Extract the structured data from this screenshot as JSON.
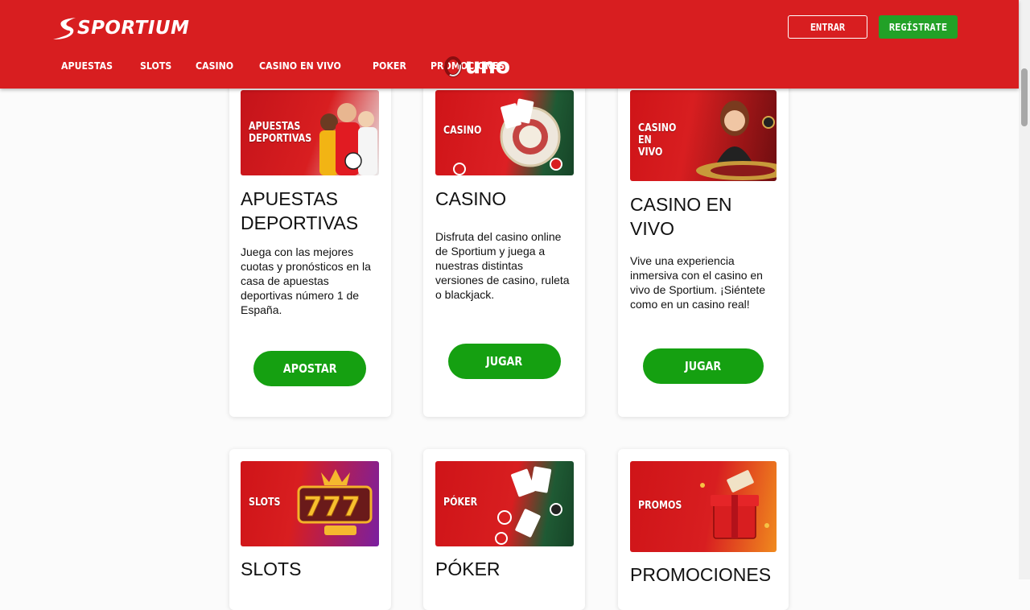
{
  "brand": {
    "name": "SPORTIUM",
    "accent": "#d81e20",
    "green": "#22a127"
  },
  "header": {
    "login_label": "ENTRAR",
    "register_label": "REGÍSTRATE",
    "nav": [
      "APUESTAS",
      "SLOTS",
      "CASINO",
      "CASINO EN VIVO",
      "POKER",
      "PROMOCIONES"
    ],
    "partner_logo": "uno"
  },
  "cards": [
    {
      "image_label": "APUESTAS DEPORTIVAS",
      "title": "APUESTAS DEPORTIVAS",
      "description": "Juega con las mejores cuotas y pronósticos en la casa de apuestas deportivas número 1 de España.",
      "button": "APOSTAR"
    },
    {
      "image_label": "CASINO",
      "title": "CASINO",
      "description": "Disfruta del casino online de Sportium y juega a nuestras distintas versiones de casino, ruleta o blackjack.",
      "button": "JUGAR"
    },
    {
      "image_label": "CASINO EN VIVO",
      "title": "CASINO EN VIVO",
      "description": "Vive una experiencia inmersiva con el casino en vivo de Sportium. ¡Siéntete como en un casino real!",
      "button": "JUGAR"
    },
    {
      "image_label": "SLOTS",
      "title": "SLOTS"
    },
    {
      "image_label": "PÓKER",
      "title": "PÓKER"
    },
    {
      "image_label": "PROMOS",
      "title": "PROMOCIONES"
    }
  ]
}
